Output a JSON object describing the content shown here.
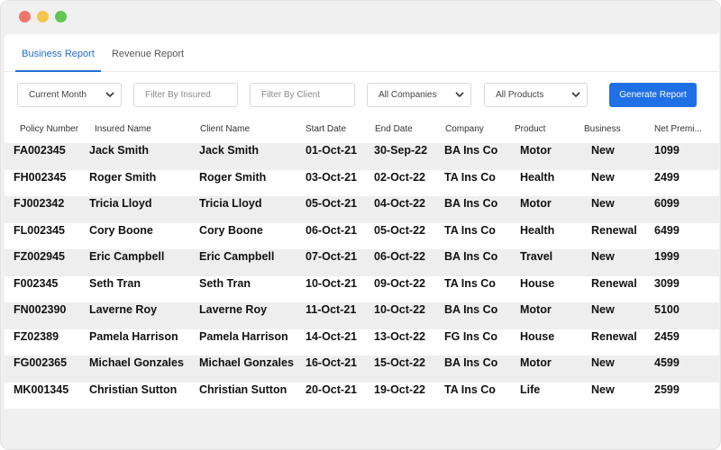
{
  "tabs": [
    {
      "label": "Business Report",
      "active": true
    },
    {
      "label": "Revenue Report",
      "active": false
    }
  ],
  "filters": {
    "period": "Current Month",
    "insured_placeholder": "Filter By Insured",
    "client_placeholder": "Filter By Client",
    "company": "All Companies",
    "product": "All Products",
    "generate_label": "Generate Report"
  },
  "table": {
    "headers": [
      "Policy Number",
      "Insured Name",
      "Client Name",
      "Start Date",
      "End Date",
      "Company",
      "Product",
      "Business",
      "Net Premi..."
    ],
    "rows": [
      [
        "FA002345",
        "Jack Smith",
        "Jack Smith",
        "01-Oct-21",
        "30-Sep-22",
        "BA Ins Co",
        "Motor",
        "New",
        "1099"
      ],
      [
        "FH002345",
        "Roger Smith",
        "Roger Smith",
        "03-Oct-21",
        "02-Oct-22",
        "TA Ins Co",
        "Health",
        "New",
        "2499"
      ],
      [
        "FJ002342",
        "Tricia Lloyd",
        "Tricia Lloyd",
        "05-Oct-21",
        "04-Oct-22",
        "BA Ins Co",
        "Motor",
        "New",
        "6099"
      ],
      [
        "FL002345",
        "Cory Boone",
        "Cory Boone",
        "06-Oct-21",
        "05-Oct-22",
        "TA Ins Co",
        "Health",
        "Renewal",
        "6499"
      ],
      [
        "FZ002945",
        "Eric Campbell",
        "Eric Campbell",
        "07-Oct-21",
        "06-Oct-22",
        "BA Ins Co",
        "Travel",
        "New",
        "1999"
      ],
      [
        "F002345",
        "Seth Tran",
        "Seth Tran",
        "10-Oct-21",
        "09-Oct-22",
        "TA Ins Co",
        "House",
        "Renewal",
        "3099"
      ],
      [
        "FN002390",
        "Laverne Roy",
        "Laverne Roy",
        "11-Oct-21",
        "10-Oct-22",
        "BA Ins Co",
        "Motor",
        "New",
        "5100"
      ],
      [
        "FZ02389",
        "Pamela Harrison",
        "Pamela Harrison",
        "14-Oct-21",
        "13-Oct-22",
        "FG Ins Co",
        "House",
        "Renewal",
        "2459"
      ],
      [
        "FG002365",
        "Michael Gonzales",
        "Michael Gonzales",
        "16-Oct-21",
        "15-Oct-22",
        "BA Ins Co",
        "Motor",
        "New",
        "4599"
      ],
      [
        "MK001345",
        "Christian Sutton",
        "Christian Sutton",
        "20-Oct-21",
        "19-Oct-22",
        "TA Ins Co",
        "Life",
        "New",
        "2599"
      ]
    ]
  },
  "colors": {
    "accent": "#1f6fe6",
    "row_alt": "#eeeeee",
    "window_bg": "#f0f0f0"
  }
}
